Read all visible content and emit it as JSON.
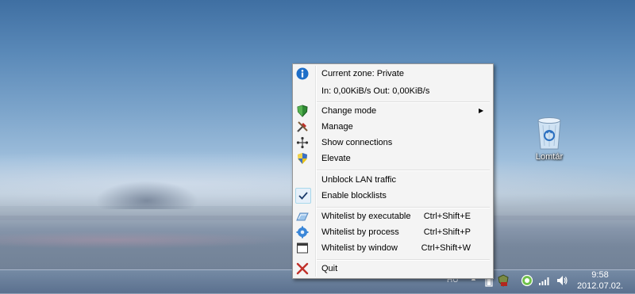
{
  "desktop": {
    "recycle_bin_label": "Lomtár"
  },
  "menu": {
    "status": {
      "zone": "Current zone: Private",
      "traffic": "In: 0,00KiB/s   Out: 0,00KiB/s"
    },
    "items": [
      {
        "label": "Change mode",
        "icon": "shield-icon",
        "has_submenu": true
      },
      {
        "label": "Manage",
        "icon": "tools-icon"
      },
      {
        "label": "Show connections",
        "icon": "network-icon"
      },
      {
        "label": "Elevate",
        "icon": "uac-shield-icon"
      }
    ],
    "toggles": [
      {
        "label": "Unblock LAN traffic",
        "checked": false
      },
      {
        "label": "Enable blocklists",
        "checked": true
      }
    ],
    "whitelist": [
      {
        "label": "Whitelist by executable",
        "shortcut": "Ctrl+Shift+E",
        "icon": "executable-icon"
      },
      {
        "label": "Whitelist by process",
        "shortcut": "Ctrl+Shift+P",
        "icon": "gear-icon"
      },
      {
        "label": "Whitelist by window",
        "shortcut": "Ctrl+Shift+W",
        "icon": "window-icon"
      }
    ],
    "quit": {
      "label": "Quit",
      "icon": "close-icon"
    }
  },
  "taskbar": {
    "hidden_label": "HU",
    "clock_time": "9:58",
    "clock_date": "2012.07.02."
  },
  "colors": {
    "menu_bg": "#f4f4f4",
    "info_blue": "#1e6ec8",
    "quit_red": "#c0302a"
  }
}
